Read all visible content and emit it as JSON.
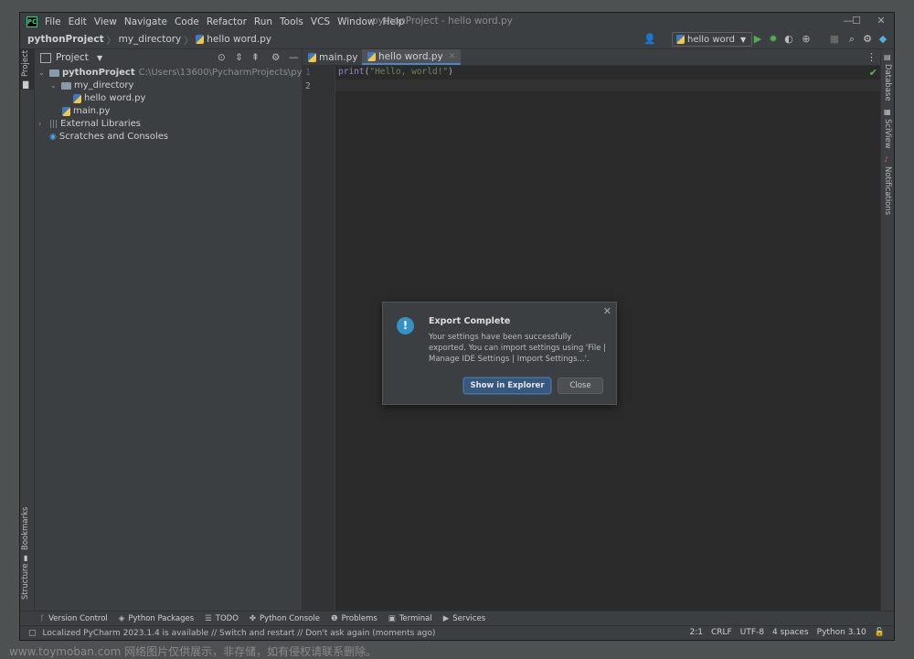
{
  "titlebar": {
    "menus": [
      "File",
      "Edit",
      "View",
      "Navigate",
      "Code",
      "Refactor",
      "Run",
      "Tools",
      "VCS",
      "Window",
      "Help"
    ],
    "window_title": "pythonProject - hello word.py"
  },
  "navbar": {
    "breadcrumb": [
      "pythonProject",
      "my_directory",
      "hello word.py"
    ],
    "run_config": "hello word"
  },
  "left_strip": {
    "project": "Project",
    "bookmarks": "Bookmarks",
    "structure": "Structure"
  },
  "right_strip": {
    "database": "Database",
    "sciview": "SciView",
    "notifications": "Notifications"
  },
  "project_panel": {
    "title": "Project",
    "tree": {
      "root": {
        "name": "pythonProject",
        "path": "C:\\Users\\13600\\PycharmProjects\\pythonProject"
      },
      "folder": "my_directory",
      "folder_file": "hello word.py",
      "root_file": "main.py",
      "external": "External Libraries",
      "scratches": "Scratches and Consoles"
    }
  },
  "editor": {
    "tabs": [
      "main.py",
      "hello word.py"
    ],
    "active_tab": 1,
    "line_numbers": [
      "1",
      "2"
    ],
    "code": {
      "fn": "print",
      "open": "(",
      "str": "\"Hello, world!\"",
      "close": ")"
    }
  },
  "dialog": {
    "title": "Export Complete",
    "message": "Your settings have been successfully exported. You can import settings using 'File | Manage IDE Settings | Import Settings...'.",
    "primary_button": "Show in Explorer",
    "secondary_button": "Close"
  },
  "bottom_tools": [
    "Version Control",
    "Python Packages",
    "TODO",
    "Python Console",
    "Problems",
    "Terminal",
    "Services"
  ],
  "statusbar": {
    "message": "Localized PyCharm 2023.1.4 is available // Switch and restart // Don't ask again (moments ago)",
    "position": "2:1",
    "line_ending": "CRLF",
    "encoding": "UTF-8",
    "indent": "4 spaces",
    "interpreter": "Python 3.10"
  },
  "watermark": "www.toymoban.com 网络图片仅供展示，非存储，如有侵权请联系删除。"
}
